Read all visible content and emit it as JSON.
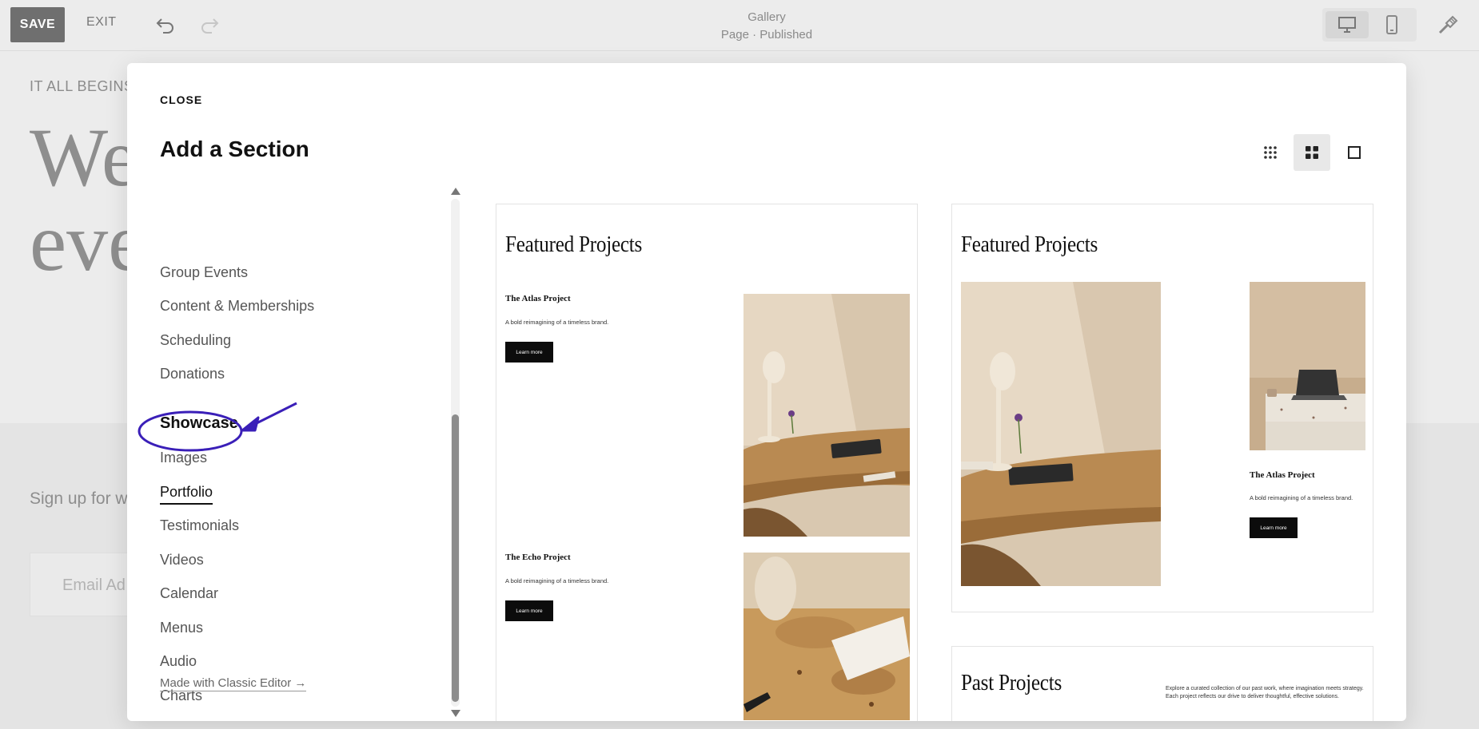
{
  "toolbar": {
    "save_label": "SAVE",
    "exit_label": "EXIT",
    "page_title": "Gallery",
    "page_status": "Page · Published",
    "icons": [
      "undo-icon",
      "redo-icon",
      "desktop-icon",
      "mobile-icon",
      "site-styles-icon"
    ]
  },
  "background": {
    "eyebrow": "IT ALL BEGINS",
    "headline_line1": "We",
    "headline_line2": "eve",
    "signup_text": "Sign up for w",
    "email_placeholder": "Email Ad"
  },
  "modal": {
    "close_label": "CLOSE",
    "title": "Add a Section",
    "view_modes": [
      "grid-small-icon",
      "grid-medium-icon",
      "single-view-icon"
    ],
    "categories_top": [
      "Group Events",
      "Content & Memberships",
      "Scheduling",
      "Donations"
    ],
    "group_heading": "Showcase",
    "categories_showcase": [
      "Images",
      "Portfolio",
      "Testimonials",
      "Videos",
      "Calendar",
      "Menus",
      "Audio",
      "Charts"
    ],
    "active_category": "Portfolio",
    "made_with_link": "Made with Classic Editor →"
  },
  "previews": {
    "card1": {
      "title": "Featured Projects",
      "item1_title": "The Atlas Project",
      "item1_text": "A bold reimagining of a timeless brand.",
      "item1_button": "Learn more",
      "item2_title": "The Echo Project",
      "item2_text": "A bold reimagining of a timeless brand.",
      "item2_button": "Learn more"
    },
    "card2": {
      "title": "Featured Projects",
      "item_title": "The Atlas Project",
      "item_text": "A bold reimagining of a timeless brand.",
      "item_button": "Learn more"
    },
    "card3": {
      "title": "Past Projects",
      "description": "Explore a curated collection of our past work, where imagination meets strategy. Each project reflects our drive to deliver thoughtful, effective solutions."
    }
  },
  "colors": {
    "annotation": "#3a1fb8",
    "accent_dark": "#0c0c0c"
  }
}
